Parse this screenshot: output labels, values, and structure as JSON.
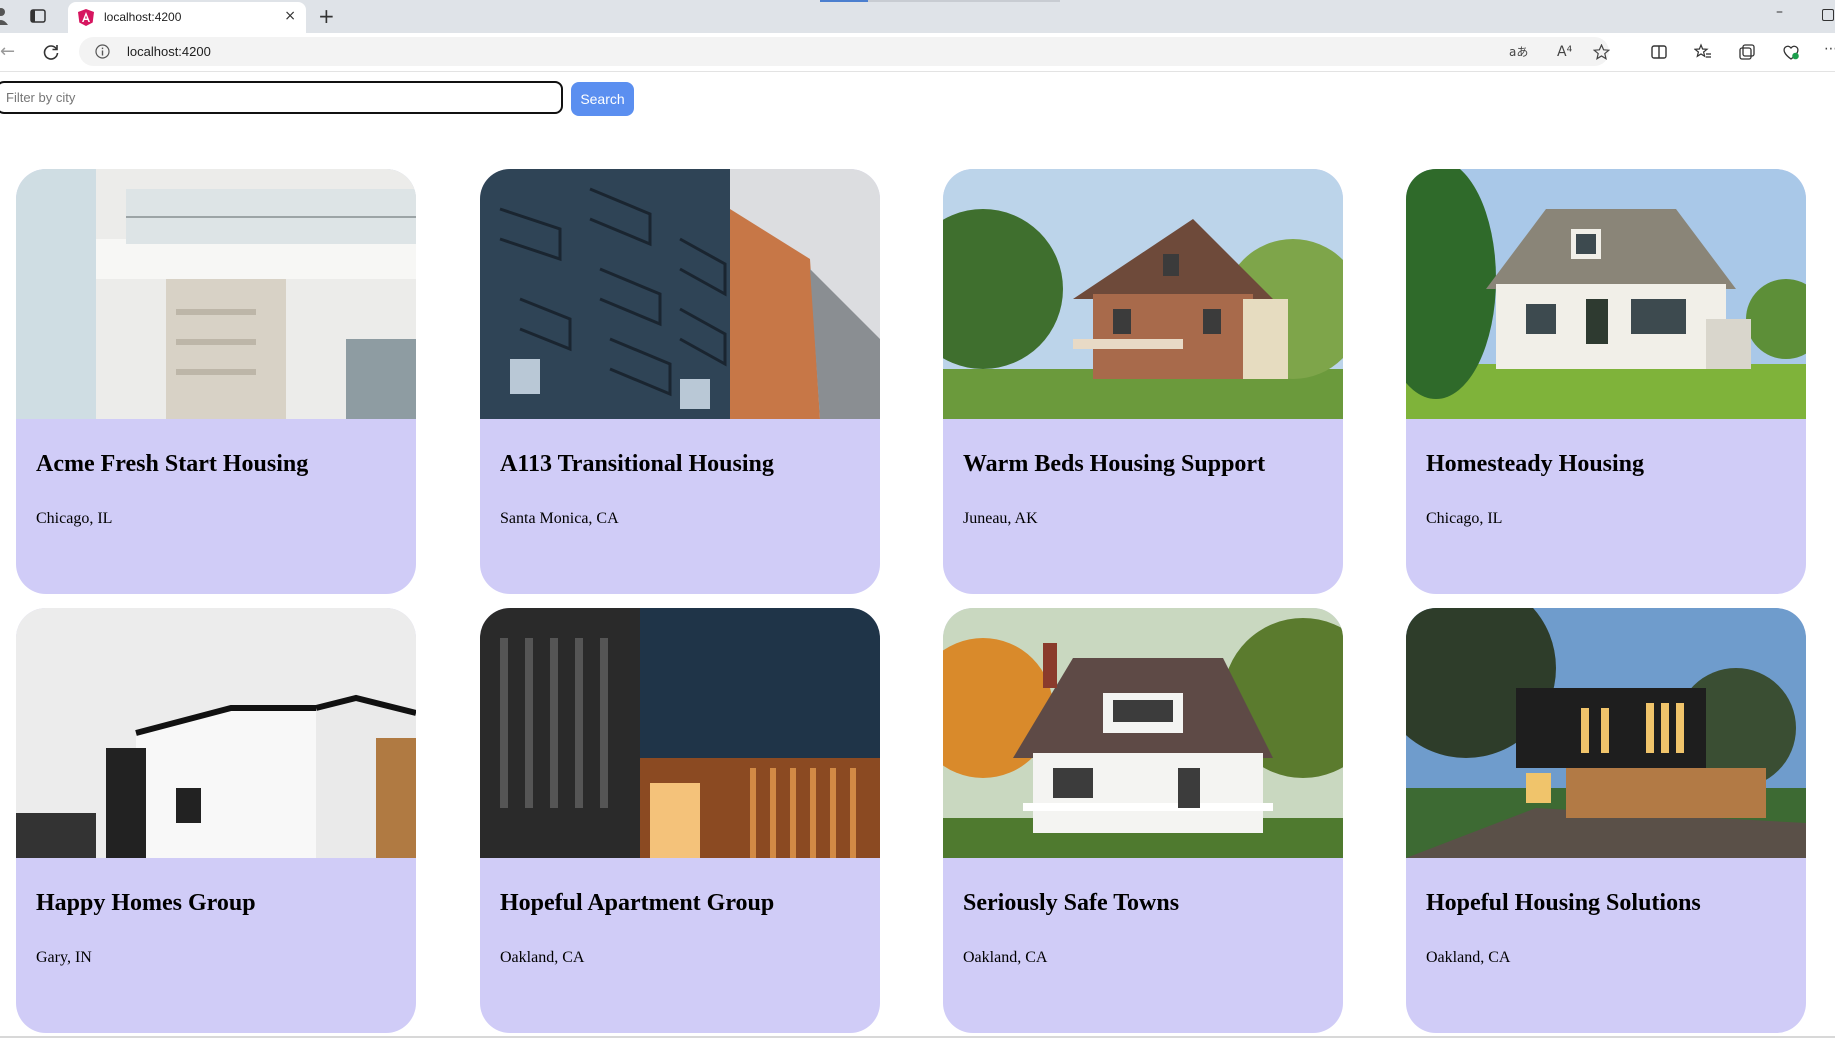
{
  "browser": {
    "tab_title": "localhost:4200",
    "tab_close": "×",
    "new_tab": "+",
    "minimize": "–",
    "back": "←",
    "url": "localhost:4200",
    "read_aloud": "A⁴",
    "accent_color": "#4c7fcf"
  },
  "filter": {
    "placeholder": "Filter by city",
    "value": "",
    "search_label": "Search",
    "button_color": "#5b8ff0"
  },
  "card_color": "#d0ccf7",
  "listings": [
    {
      "name": "Acme Fresh Start Housing",
      "location": "Chicago, IL",
      "image": "modern white apartment building with glass balconies"
    },
    {
      "name": "A113 Transitional Housing",
      "location": "Santa Monica, CA",
      "image": "blue and orange apartment facade with balconies"
    },
    {
      "name": "Warm Beds Housing Support",
      "location": "Juneau, AK",
      "image": "brick victorian house with trees"
    },
    {
      "name": "Homesteady Housing",
      "location": "Chicago, IL",
      "image": "white cottage house with green lawn"
    },
    {
      "name": "Happy Homes Group",
      "location": "Gary, IN",
      "image": "modern white house with black trim"
    },
    {
      "name": "Hopeful Apartment Group",
      "location": "Oakland, CA",
      "image": "dark modern building with wood slats"
    },
    {
      "name": "Seriously Safe Towns",
      "location": "Oakland, CA",
      "image": "white house with porch among autumn trees"
    },
    {
      "name": "Hopeful Housing Solutions",
      "location": "Oakland, CA",
      "image": "modern black house at dusk"
    }
  ]
}
